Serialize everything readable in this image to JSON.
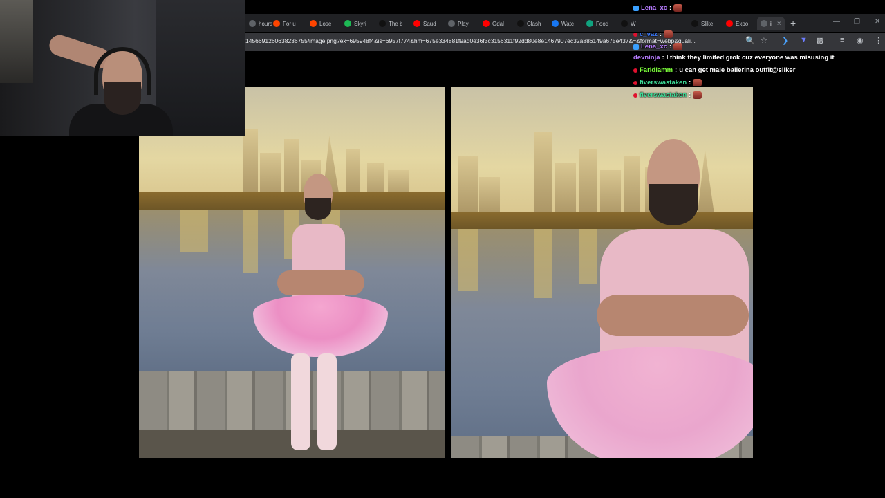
{
  "tabs": [
    {
      "label": "hours",
      "favicon": "clock-icon",
      "color": "#5f6368"
    },
    {
      "label": "For u",
      "favicon": "reddit-icon",
      "color": "#ff4500"
    },
    {
      "label": "Lose",
      "favicon": "reddit-icon",
      "color": "#ff4500"
    },
    {
      "label": "Skyri",
      "favicon": "spotify-icon",
      "color": "#1db954"
    },
    {
      "label": "The b",
      "favicon": "tiktok-icon",
      "color": "#111111"
    },
    {
      "label": "Saud",
      "favicon": "youtube-icon",
      "color": "#ff0000"
    },
    {
      "label": "Play",
      "favicon": "globe-icon",
      "color": "#5f6368"
    },
    {
      "label": "Odal",
      "favicon": "youtube-icon",
      "color": "#ff0000"
    },
    {
      "label": "Clash",
      "favicon": "x-icon",
      "color": "#111111"
    },
    {
      "label": "Watc",
      "favicon": "meta-icon",
      "color": "#1877f2"
    },
    {
      "label": "Food",
      "favicon": "openai-icon",
      "color": "#10a37f"
    },
    {
      "label": "W",
      "favicon": "wikipedia-icon",
      "color": "#111111"
    },
    {
      "label": "Slike",
      "favicon": "x-icon",
      "color": "#111111"
    },
    {
      "label": "Expo",
      "favicon": "youtube-icon",
      "color": "#ff0000"
    },
    {
      "label": "i",
      "favicon": "globe-icon",
      "color": "#5f6368"
    }
  ],
  "address_bar": {
    "url": "1456691260638236755/image.png?ex=695948f4&is=6957f774&hm=675e334881f9ad0e36f3c3156311f92dd80e8e1467907ec32a886149a675e437&=&format=webp&quali..."
  },
  "chat": [
    {
      "user": "Lena_xc",
      "text": "",
      "user_color": "#b77cff",
      "emote": true,
      "badge_color": "#3aa0ff"
    },
    {
      "user": "c_vaz",
      "text": "",
      "user_color": "#3b7bff",
      "emote": true,
      "badge_color": "#e0102e"
    },
    {
      "user": "Lena_xc",
      "text": "",
      "user_color": "#b77cff",
      "emote": true,
      "badge_color": "#3aa0ff"
    },
    {
      "user": "devninja",
      "text": "I think they limited grok cuz everyone was misusing it",
      "user_color": "#b77cff",
      "emote": false,
      "badge_color": ""
    },
    {
      "user": "Faridlamm",
      "text": "u can get male ballerina outfit@sliker",
      "user_color": "#7cff3a",
      "emote": false,
      "badge_color": "#e0102e"
    },
    {
      "user": "fiverswastaken",
      "text": "",
      "user_color": "#3ddc97",
      "emote": true,
      "badge_color": "#e0102e"
    },
    {
      "user": "fiverswastaken",
      "text": "",
      "user_color": "#3ddc97",
      "emote": true,
      "badge_color": "#e0102e"
    }
  ]
}
